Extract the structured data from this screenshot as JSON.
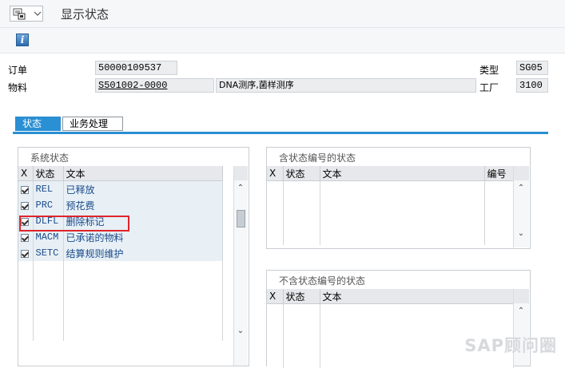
{
  "header": {
    "title": "显示状态"
  },
  "toolbar": {
    "info_icon": "info-icon",
    "info_glyph": "i"
  },
  "fields": {
    "order_label": "订单",
    "order_value": "50000109537",
    "type_label": "类型",
    "type_value": "SG05",
    "material_label": "物料",
    "material_value": "S501002-0000",
    "material_desc": "DNA测序,菌样测序",
    "plant_label": "工厂",
    "plant_value": "3100"
  },
  "tabs": [
    {
      "label": "状态"
    },
    {
      "label": "业务处理"
    }
  ],
  "system_status": {
    "title": "系统状态",
    "headers": [
      "X",
      "状态",
      "文本"
    ],
    "rows": [
      {
        "checked": true,
        "code": "REL",
        "text": "已释放"
      },
      {
        "checked": true,
        "code": "PRC",
        "text": "预花费"
      },
      {
        "checked": true,
        "code": "DLFL",
        "text": "删除标记"
      },
      {
        "checked": true,
        "code": "MACM",
        "text": "已承诺的物料"
      },
      {
        "checked": true,
        "code": "SETC",
        "text": "结算规则维护"
      }
    ]
  },
  "status_with_number": {
    "title": "含状态编号的状态",
    "headers": [
      "X",
      "状态",
      "文本",
      "编号"
    ]
  },
  "status_without_number": {
    "title": "不含状态编号的状态",
    "headers": [
      "X",
      "状态",
      "文本"
    ]
  },
  "watermark": "SAP顾问圈",
  "colors": {
    "accent": "#2a8fd3",
    "highlight": "#e0252b",
    "text_blue": "#1a4b8a"
  }
}
